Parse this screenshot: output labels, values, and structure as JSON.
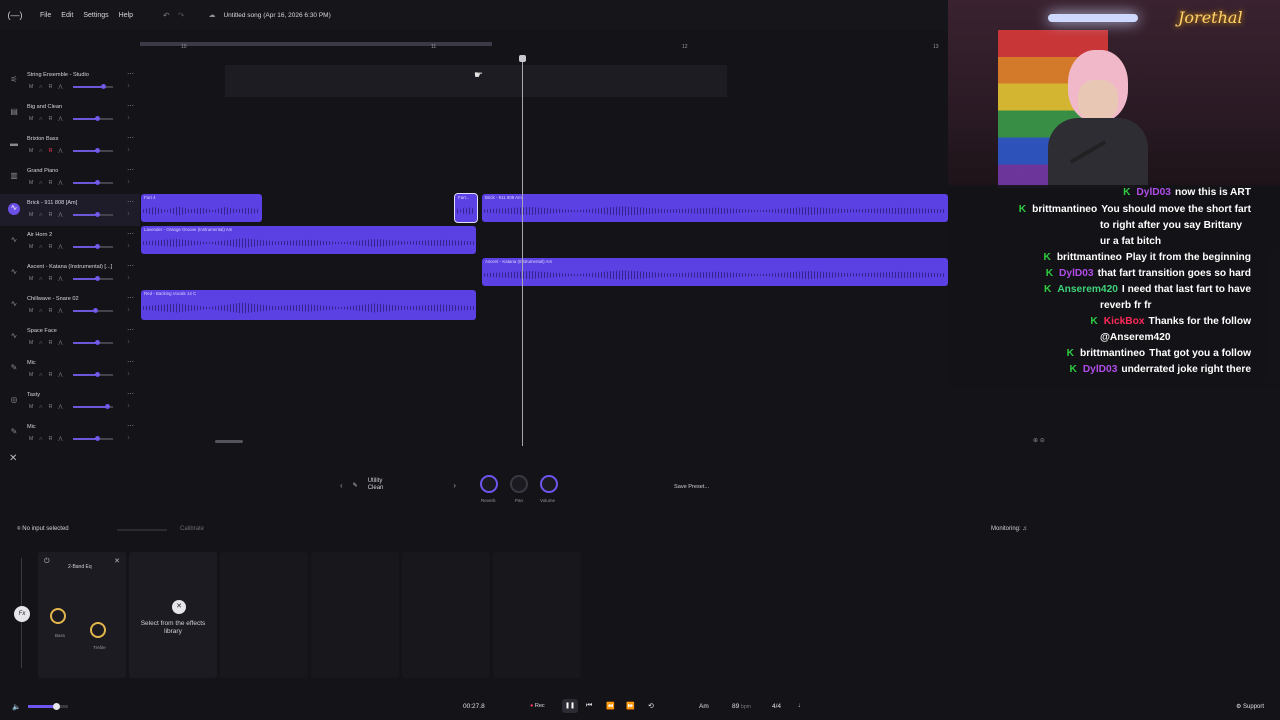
{
  "topbar": {
    "logo": "(—)",
    "menu": [
      "File",
      "Edit",
      "Settings",
      "Help"
    ],
    "song_title": "Untitled song (Apr 16, 2026 6:30 PM)"
  },
  "ruler": {
    "marks": [
      "10",
      "11",
      "12",
      "13"
    ]
  },
  "tracks": [
    {
      "name": "String Ensemble - Studio",
      "icon": "strings-icon",
      "volume": 0.75
    },
    {
      "name": "Big and Clean",
      "icon": "keyboard-icon",
      "volume": 0.6
    },
    {
      "name": "Brixton Bass",
      "icon": "bass-icon",
      "volume": 0.6,
      "record_armed": true
    },
    {
      "name": "Grand Piano",
      "icon": "piano-icon",
      "volume": 0.6
    },
    {
      "name": "Brick - 911 808 [Am]",
      "icon": "waveform-icon",
      "volume": 0.6,
      "selected": true
    },
    {
      "name": "Air Horn 2",
      "icon": "waveform-icon",
      "volume": 0.6
    },
    {
      "name": "Ascent - Katana (Instrumental) [...]",
      "icon": "waveform-icon",
      "volume": 0.6
    },
    {
      "name": "Chillwave - Snare 02",
      "icon": "waveform-icon",
      "volume": 0.55
    },
    {
      "name": "Space Face",
      "icon": "waveform-icon",
      "volume": 0.6
    },
    {
      "name": "Mic",
      "icon": "mic-icon",
      "volume": 0.6
    },
    {
      "name": "Tasty",
      "icon": "drums-icon",
      "volume": 0.85
    },
    {
      "name": "Mic",
      "icon": "mic-icon",
      "volume": 0.6
    }
  ],
  "track_controls": {
    "mute": "M",
    "solo": "S",
    "rec": "R"
  },
  "clips": {
    "fart4": "Fart 4",
    "fart_short": "Fart...",
    "brick": "Brick - 911 808 Am",
    "lavender": "Lavender - Orange Groove (Instrumental) Am",
    "ascent": "Ascent - Katana (Instrumental) Am",
    "red": "Red - Backing Vocals 14 C"
  },
  "preset": {
    "name_line1": "Utility",
    "name_line2": "Clean",
    "save_label": "Save Preset..."
  },
  "knobs": {
    "reverb": "Reverb",
    "pan": "Pan",
    "volume": "Volume"
  },
  "input": {
    "no_input": "No input selected",
    "calibrate": "Calibrate",
    "monitoring": "Monitoring:"
  },
  "effects": {
    "fx_label": "Fx",
    "eq_title": "2-Band Eq",
    "bass": "Bass",
    "treble": "Treble",
    "select_text": "Select from the effects library"
  },
  "transport": {
    "master_volume": 0.7,
    "time": "00:27.8",
    "rec_label": "Rec",
    "key": "Am",
    "bpm": "89",
    "bpm_unit": "bpm",
    "time_signature": "4/4",
    "support": "Support"
  },
  "webcam": {
    "neon_sign": "Jorethal"
  },
  "chat": [
    {
      "user": "DylD03",
      "color": "#b04de8",
      "text": "now this is ART"
    },
    {
      "user": "brittmantineo",
      "color": "#ffffff",
      "text": "You should move the short fart",
      "cont": [
        "to right after you say Brittany",
        "ur a fat bitch"
      ]
    },
    {
      "user": "brittmantineo",
      "color": "#ffffff",
      "text": "Play it from the beginning"
    },
    {
      "user": "DylD03",
      "color": "#b04de8",
      "text": "that fart transition goes so hard"
    },
    {
      "user": "Anserem420",
      "color": "#3fd07a",
      "text": "I need that last fart to have",
      "cont": [
        "reverb fr fr"
      ]
    },
    {
      "user": "KickBox",
      "color": "#ff2a5a",
      "text": "Thanks for the follow",
      "cont": [
        "@Anserem420"
      ]
    },
    {
      "user": "brittmantineo",
      "color": "#ffffff",
      "text": "That got you a follow"
    },
    {
      "user": "DylD03",
      "color": "#b04de8",
      "text": "underrated joke right there"
    }
  ]
}
